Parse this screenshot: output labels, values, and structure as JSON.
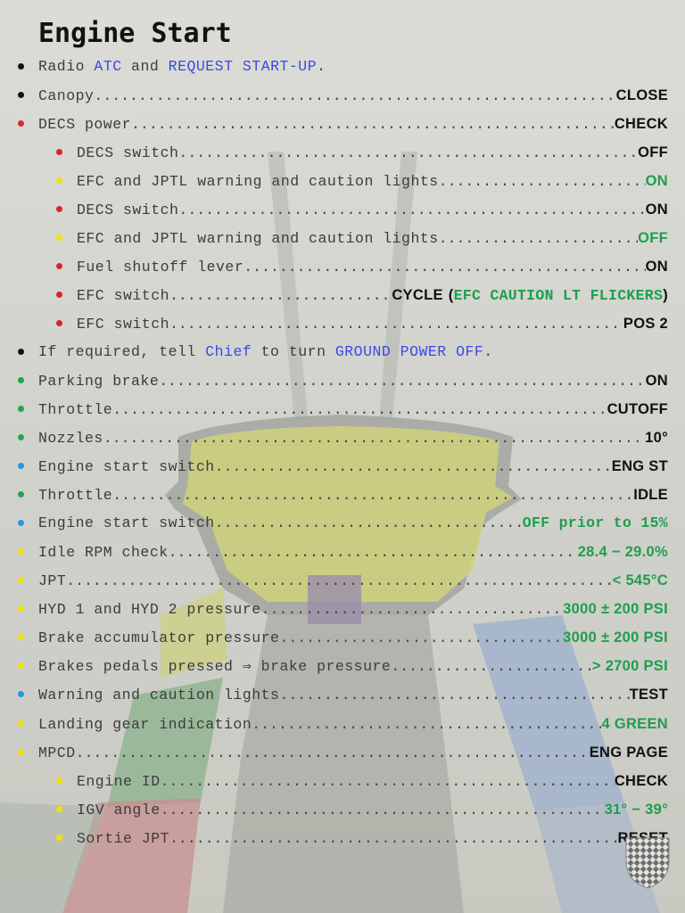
{
  "page": {
    "title": "Engine Start",
    "colors": {
      "red": "#d8262b",
      "yellow": "#f2e200",
      "green": "#22a64b",
      "blue": "#1e9ae0",
      "black": "#111111",
      "value_green": "#1e9e4e",
      "link_blue": "#3a49e8"
    }
  },
  "items": {
    "radio": {
      "t1": "Radio",
      "l1": "ATC",
      "t2": "and",
      "l2": "REQUEST START-UP",
      "t3": "."
    },
    "canopy": {
      "label": "Canopy",
      "value": "CLOSE"
    },
    "decs_power": {
      "label": "DECS power",
      "value": "CHECK"
    },
    "decs_switch_off": {
      "label": "DECS switch",
      "value": "OFF"
    },
    "efc_lights_on": {
      "label": "EFC and JPTL warning and caution lights",
      "value": "ON"
    },
    "decs_switch_on": {
      "label": "DECS switch",
      "value": "ON"
    },
    "efc_lights_off": {
      "label": "EFC and JPTL warning and caution lights",
      "value": "OFF"
    },
    "fuel_shutoff": {
      "label": "Fuel shutoff lever",
      "value": "ON"
    },
    "efc_cycle": {
      "label": "EFC switch",
      "value": "CYCLE",
      "paren_open": "(",
      "note": "EFC CAUTION LT FLICKERS",
      "paren_close": ")"
    },
    "efc_pos2": {
      "label": "EFC switch",
      "value": "POS 2"
    },
    "chief": {
      "t1": "If required, tell",
      "l1": "Chief",
      "t2": "to turn",
      "l2": "GROUND POWER OFF",
      "t3": "."
    },
    "parking_brake": {
      "label": "Parking brake",
      "value": "ON"
    },
    "throttle_cutoff": {
      "label": "Throttle",
      "value": "CUTOFF"
    },
    "nozzles": {
      "label": "Nozzles",
      "value": "10°"
    },
    "eng_start_st": {
      "label": "Engine start switch",
      "value": "ENG ST"
    },
    "throttle_idle": {
      "label": "Throttle",
      "value": "IDLE"
    },
    "eng_start_off": {
      "label": "Engine start switch",
      "value": "OFF prior to 15%"
    },
    "idle_rpm": {
      "label": "Idle RPM check",
      "value": "28.4 − 29.0%"
    },
    "jpt": {
      "label": "JPT",
      "value": "< 545°C"
    },
    "hyd_pressure": {
      "label": "HYD 1 and HYD 2 pressure",
      "value": "3000 ± 200 PSI"
    },
    "brake_accum": {
      "label": "Brake accumulator pressure",
      "value": "3000 ± 200 PSI"
    },
    "brake_pedals": {
      "label": "Brakes pedals pressed ⇒ brake pressure",
      "value": "> 2700 PSI"
    },
    "warning_lights": {
      "label": "Warning and caution lights",
      "value": "TEST"
    },
    "landing_gear": {
      "label": "Landing gear indication",
      "value": "4 GREEN"
    },
    "mpcd": {
      "label": "MPCD",
      "value": "ENG PAGE"
    },
    "engine_id": {
      "label": "Engine ID",
      "value": "CHECK"
    },
    "igv_angle": {
      "label": "IGV angle",
      "value": "31° − 39°"
    },
    "sortie_jpt": {
      "label": "Sortie JPT",
      "value": "RESET"
    }
  }
}
